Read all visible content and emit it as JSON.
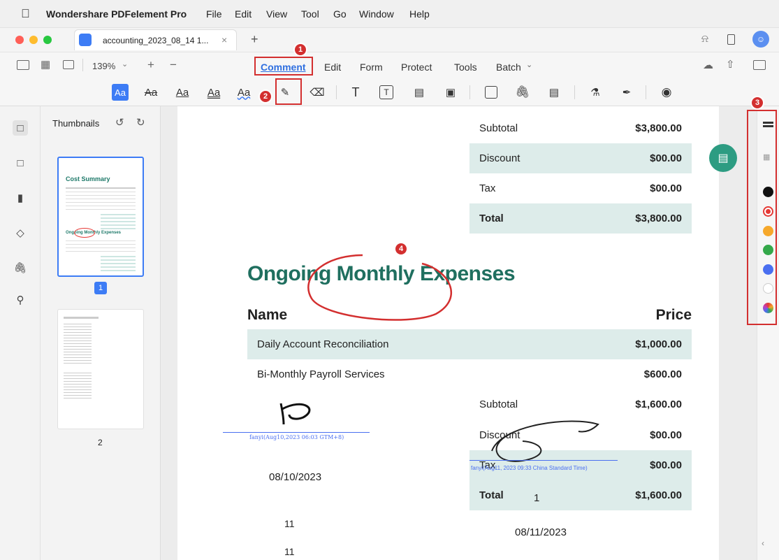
{
  "menubar": {
    "app_name": "Wondershare PDFelement Pro",
    "items": [
      "File",
      "Edit",
      "View",
      "Tool",
      "Go",
      "Window",
      "Help"
    ]
  },
  "tab": {
    "title": "accounting_2023_08_14 1...",
    "close": "×",
    "new_tab": "+"
  },
  "toolbar": {
    "zoom": "139%",
    "tabs": [
      "Comment",
      "Edit",
      "Form",
      "Protect",
      "Tools",
      "Batch"
    ],
    "active_tab": "Comment",
    "text_styles": [
      "Aa",
      "Aa",
      "Aa",
      "Aa",
      "Aa"
    ]
  },
  "thumbnails": {
    "title": "Thumbnails",
    "page1_label": "1",
    "page2_label": "2",
    "mini_title": "Cost Summary",
    "mini_heading": "Ongoing Monthly Expenses"
  },
  "document": {
    "top_summary": [
      {
        "label": "Subtotal",
        "value": "$3,800.00"
      },
      {
        "label": "Discount",
        "value": "$00.00"
      },
      {
        "label": "Tax",
        "value": "$00.00"
      },
      {
        "label": "Total",
        "value": "$3,800.00"
      }
    ],
    "section_title": "Ongoing Monthly Expenses",
    "col_name": "Name",
    "col_price": "Price",
    "items": [
      {
        "name": "Daily Account Reconciliation",
        "price": "$1,000.00"
      },
      {
        "name": "Bi-Monthly Payroll Services",
        "price": "$600.00"
      }
    ],
    "bottom_summary": [
      {
        "label": "Subtotal",
        "value": "$1,600.00"
      },
      {
        "label": "Discount",
        "value": "$00.00"
      },
      {
        "label": "Tax",
        "value": "$00.00"
      },
      {
        "label": "Total",
        "value": "$1,600.00"
      }
    ],
    "signature_caption_1": "fanyi(Aug10,2023 06:03 GTM+8)",
    "signature_caption_2": "fanyi(Aug11, 2023 09:33 China Standard Time)",
    "date_1": "08/10/2023",
    "date_2": "08/11/2023",
    "number_1": "1",
    "number_11a": "11",
    "number_11b": "11"
  },
  "badges": [
    "1",
    "2",
    "3",
    "4"
  ],
  "palette": {
    "colors": [
      "#111111",
      "#e53935",
      "#f6a82b",
      "#34a84a",
      "#4a6ff0",
      "#ffffff"
    ],
    "accent": "#1f7a6a",
    "highlight_row": "#ddecea",
    "annotation_red": "#d32f2f"
  }
}
